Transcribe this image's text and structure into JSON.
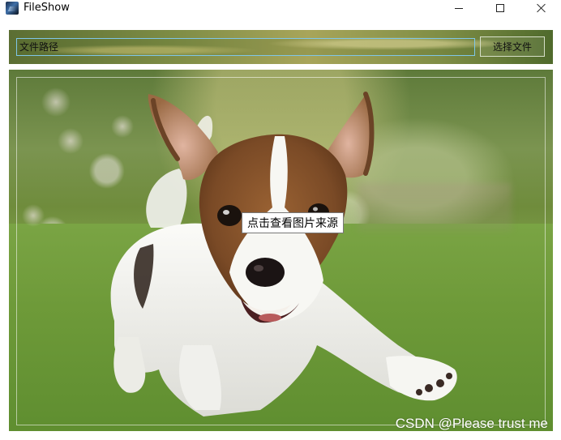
{
  "window": {
    "title": "FileShow",
    "app_icon": "fileshow-app-icon",
    "controls": {
      "minimize_icon": "minimize-icon",
      "maximize_icon": "maximize-icon",
      "close_icon": "close-icon"
    }
  },
  "file_selector": {
    "path_placeholder": "文件路径",
    "path_value": "",
    "select_button_label": "选择文件",
    "input_border_color": "#7fc7e8"
  },
  "image_view": {
    "subject": "jack-russell-puppy-photo",
    "source_link_label": "点击查看图片来源"
  },
  "watermark": "CSDN @Please trust me"
}
